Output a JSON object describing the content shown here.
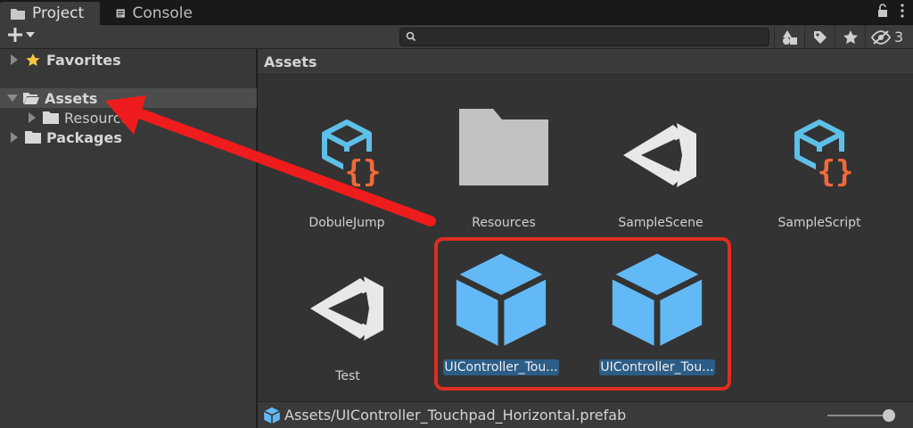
{
  "tabs": [
    {
      "label": "Project",
      "icon": "folder-icon",
      "active": true
    },
    {
      "label": "Console",
      "icon": "console-icon",
      "active": false
    }
  ],
  "toolbar": {
    "search_value": "",
    "hidden_count": "3"
  },
  "tree": {
    "items": [
      {
        "label": "Favorites",
        "icon": "star-icon",
        "expanded": false,
        "selected": false
      },
      {
        "label": "Assets",
        "icon": "folder-open-icon",
        "expanded": true,
        "selected": true
      },
      {
        "label": "Resources",
        "icon": "folder-icon",
        "expanded": false,
        "selected": false
      },
      {
        "label": "Packages",
        "icon": "folder-icon",
        "expanded": false,
        "selected": false
      }
    ]
  },
  "content": {
    "header": "Assets",
    "items": [
      {
        "label": "DobuleJump",
        "icon": "csharp-script-icon",
        "selected": false
      },
      {
        "label": "Resources",
        "icon": "folder-icon",
        "selected": false
      },
      {
        "label": "SampleScene",
        "icon": "unity-scene-icon",
        "selected": false
      },
      {
        "label": "SampleScript",
        "icon": "csharp-script-icon",
        "selected": false
      },
      {
        "label": "Test",
        "icon": "unity-scene-icon",
        "selected": false
      },
      {
        "label": "UIController_Tou...",
        "icon": "prefab-icon",
        "selected": true
      },
      {
        "label": "UIController_Tou...",
        "icon": "prefab-icon",
        "selected": true
      }
    ]
  },
  "status": {
    "path": "Assets/UIController_Touchpad_Horizontal.prefab"
  },
  "colors": {
    "annotation_red": "#e02d20",
    "selection_blue": "#2c5d87",
    "script_blue": "#5ec0e8",
    "script_orange": "#f06a3a",
    "prefab_blue": "#62b9f5"
  }
}
